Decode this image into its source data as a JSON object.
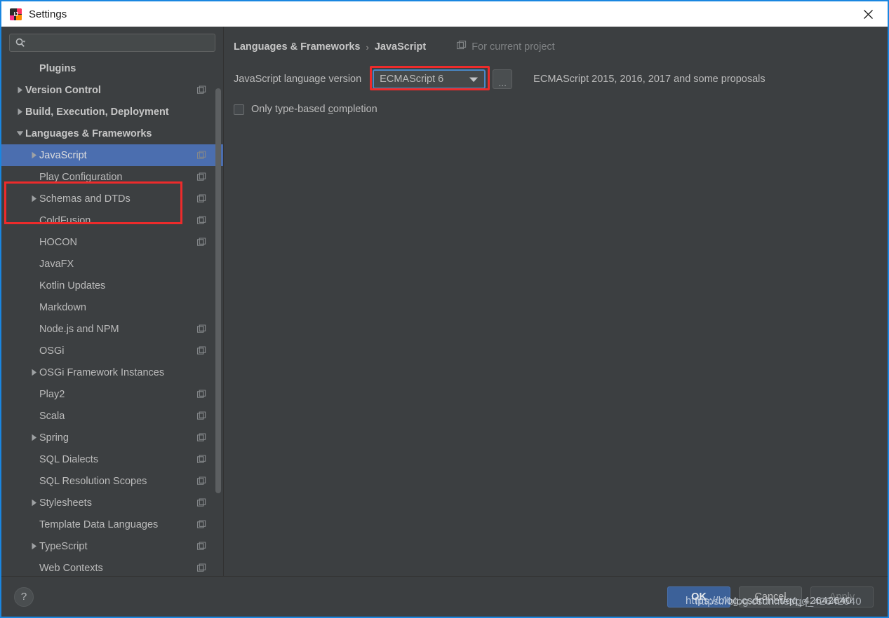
{
  "window": {
    "title": "Settings",
    "app_icon": "intellij-idea-icon",
    "close_icon": "close-icon",
    "border_color": "#1a86e0"
  },
  "sidebar": {
    "search": {
      "placeholder": "",
      "value": "",
      "icon": "search-icon",
      "dropdown_icon": "chevron-down-icon"
    },
    "scrollbar": {
      "thumb_top_pct": 6,
      "thumb_height_pct": 78
    },
    "items": [
      {
        "label": "Plugins",
        "indent": 1,
        "bold": true,
        "arrow": "none",
        "badge": false,
        "selected": false
      },
      {
        "label": "Version Control",
        "indent": 0,
        "bold": true,
        "arrow": "collapsed",
        "badge": true,
        "selected": false
      },
      {
        "label": "Build, Execution, Deployment",
        "indent": 0,
        "bold": true,
        "arrow": "collapsed",
        "badge": false,
        "selected": false
      },
      {
        "label": "Languages & Frameworks",
        "indent": 0,
        "bold": true,
        "arrow": "expanded",
        "badge": false,
        "selected": false
      },
      {
        "label": "JavaScript",
        "indent": 1,
        "bold": false,
        "arrow": "collapsed",
        "badge": true,
        "selected": true
      },
      {
        "label": "Play Configuration",
        "indent": 1,
        "bold": false,
        "arrow": "none",
        "badge": true,
        "selected": false
      },
      {
        "label": "Schemas and DTDs",
        "indent": 1,
        "bold": false,
        "arrow": "collapsed",
        "badge": true,
        "selected": false
      },
      {
        "label": "ColdFusion",
        "indent": 1,
        "bold": false,
        "arrow": "none",
        "badge": true,
        "selected": false
      },
      {
        "label": "HOCON",
        "indent": 1,
        "bold": false,
        "arrow": "none",
        "badge": true,
        "selected": false
      },
      {
        "label": "JavaFX",
        "indent": 1,
        "bold": false,
        "arrow": "none",
        "badge": false,
        "selected": false
      },
      {
        "label": "Kotlin Updates",
        "indent": 1,
        "bold": false,
        "arrow": "none",
        "badge": false,
        "selected": false
      },
      {
        "label": "Markdown",
        "indent": 1,
        "bold": false,
        "arrow": "none",
        "badge": false,
        "selected": false
      },
      {
        "label": "Node.js and NPM",
        "indent": 1,
        "bold": false,
        "arrow": "none",
        "badge": true,
        "selected": false
      },
      {
        "label": "OSGi",
        "indent": 1,
        "bold": false,
        "arrow": "none",
        "badge": true,
        "selected": false
      },
      {
        "label": "OSGi Framework Instances",
        "indent": 1,
        "bold": false,
        "arrow": "collapsed",
        "badge": false,
        "selected": false
      },
      {
        "label": "Play2",
        "indent": 1,
        "bold": false,
        "arrow": "none",
        "badge": true,
        "selected": false
      },
      {
        "label": "Scala",
        "indent": 1,
        "bold": false,
        "arrow": "none",
        "badge": true,
        "selected": false
      },
      {
        "label": "Spring",
        "indent": 1,
        "bold": false,
        "arrow": "collapsed",
        "badge": true,
        "selected": false
      },
      {
        "label": "SQL Dialects",
        "indent": 1,
        "bold": false,
        "arrow": "none",
        "badge": true,
        "selected": false
      },
      {
        "label": "SQL Resolution Scopes",
        "indent": 1,
        "bold": false,
        "arrow": "none",
        "badge": true,
        "selected": false
      },
      {
        "label": "Stylesheets",
        "indent": 1,
        "bold": false,
        "arrow": "collapsed",
        "badge": true,
        "selected": false
      },
      {
        "label": "Template Data Languages",
        "indent": 1,
        "bold": false,
        "arrow": "none",
        "badge": true,
        "selected": false
      },
      {
        "label": "TypeScript",
        "indent": 1,
        "bold": false,
        "arrow": "collapsed",
        "badge": true,
        "selected": false
      },
      {
        "label": "Web Contexts",
        "indent": 1,
        "bold": false,
        "arrow": "none",
        "badge": true,
        "selected": false
      }
    ]
  },
  "content": {
    "breadcrumb": {
      "parent": "Languages & Frameworks",
      "separator": "›",
      "current": "JavaScript"
    },
    "scope": {
      "icon": "project-scope-icon",
      "label": "For current project"
    },
    "language_version": {
      "label": "JavaScript language version",
      "selected": "ECMAScript 6",
      "dropdown_icon": "chevron-down-icon",
      "ellipsis_button": "...",
      "description": "ECMAScript 2015, 2016, 2017 and some proposals"
    },
    "only_type_based_completion": {
      "label_before": "Only type-based ",
      "label_mnemonic": "c",
      "label_after": "ompletion",
      "checked": false
    }
  },
  "footer": {
    "help_label": "?",
    "ok_label": "OK",
    "cancel_label": "Cancel",
    "apply_label": "Apply",
    "apply_enabled": false
  },
  "annotations": {
    "accent_red": "#ed2b2b",
    "selection_blue": "#4b6eaf",
    "focus_blue": "#4a88c7"
  },
  "watermark": {
    "line_a": "https://blog.csdn.net/qq_42642640",
    "line_b": "https://blog.csdn.net/qq_42642640"
  }
}
